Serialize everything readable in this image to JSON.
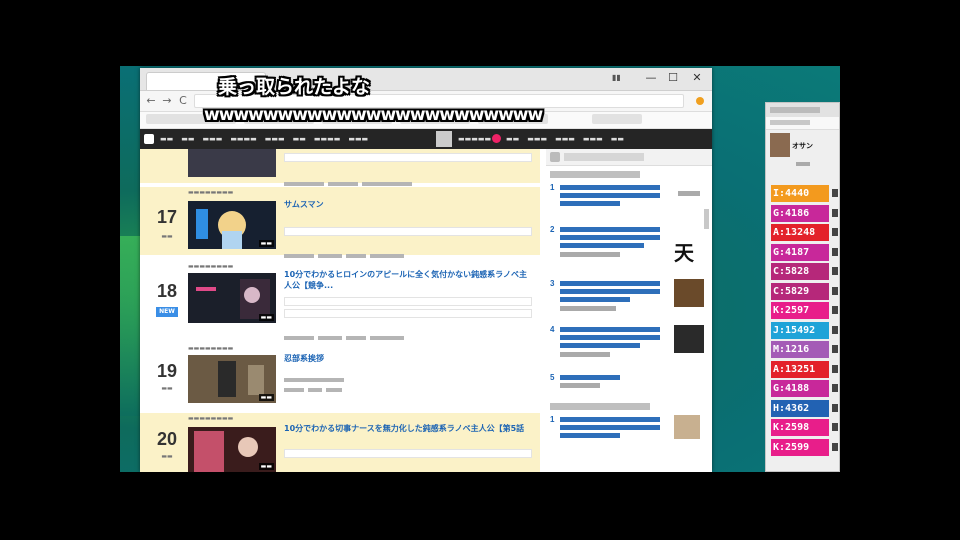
{
  "overlay_comments": [
    "乗っ取られたよな",
    "wwwwwwwwwwwwwwwwwwwwwww"
  ],
  "browser": {
    "window_controls": [
      "—",
      "☐",
      "✕"
    ],
    "nav_buttons": [
      "←",
      "→",
      "C"
    ]
  },
  "ranking": [
    {
      "rank": "17",
      "title": "サムスマン"
    },
    {
      "rank": "18",
      "title": "10分でわかるヒロインのアピールに全く気付かない鈍感系ラノベ主人公【競争..."
    },
    {
      "rank": "19",
      "title": "忍部系挨拶"
    },
    {
      "rank": "20",
      "title": "10分でわかる切事ナースを無力化した鈍感系ラノベ主人公【第5話"
    }
  ],
  "sidebar": {
    "kanji": "天",
    "item_numbers": [
      "1",
      "2",
      "3",
      "4",
      "5",
      "1"
    ]
  },
  "chat": {
    "name": "オサン",
    "tags": [
      {
        "text": "I:4440",
        "color": "#f39a1e"
      },
      {
        "text": "G:4186",
        "color": "#c8289a"
      },
      {
        "text": "A:13248",
        "color": "#e3212a"
      },
      {
        "text": "G:4187",
        "color": "#c8289a"
      },
      {
        "text": "C:5828",
        "color": "#b6287a"
      },
      {
        "text": "C:5829",
        "color": "#b6287a"
      },
      {
        "text": "K:2597",
        "color": "#e81e8a"
      },
      {
        "text": "J:15492",
        "color": "#1fa3d8"
      },
      {
        "text": "M:1216",
        "color": "#a45bb6"
      },
      {
        "text": "A:13251",
        "color": "#e3212a"
      },
      {
        "text": "G:4188",
        "color": "#c8289a"
      },
      {
        "text": "H:4362",
        "color": "#2262b3"
      },
      {
        "text": "K:2598",
        "color": "#e81e8a"
      },
      {
        "text": "K:2599",
        "color": "#e81e8a"
      }
    ]
  }
}
